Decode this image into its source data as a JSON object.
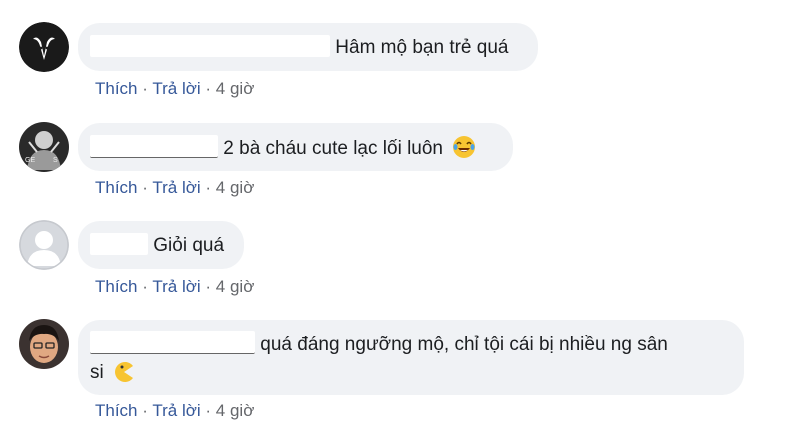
{
  "comments": [
    {
      "text": "Hâm mộ bạn trẻ quá",
      "actions": {
        "like": "Thích",
        "reply": "Trả lời",
        "time": "4 giờ"
      }
    },
    {
      "text": "2 bà cháu cute lạc lối luôn",
      "emoji": "laughing-tears-emoji",
      "actions": {
        "like": "Thích",
        "reply": "Trả lời",
        "time": "4 giờ"
      }
    },
    {
      "text": "Giỏi quá",
      "actions": {
        "like": "Thích",
        "reply": "Trả lời",
        "time": "4 giờ"
      }
    },
    {
      "text_line1": "quá đáng ngưỡng mộ, chỉ tội cái bị nhiều ng sân",
      "text_line2": "si",
      "emoji": "pacman-emoji",
      "actions": {
        "like": "Thích",
        "reply": "Trả lời",
        "time": "4 giờ"
      }
    }
  ],
  "separator": "·",
  "colors": {
    "bubble": "#f0f2f5",
    "link": "#365899",
    "meta": "#65676b"
  }
}
